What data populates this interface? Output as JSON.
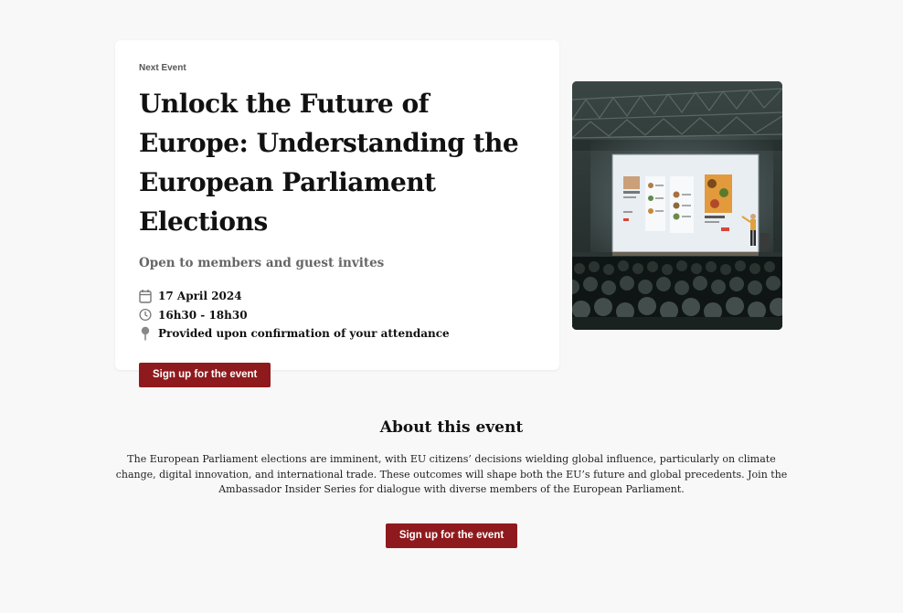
{
  "event": {
    "eyebrow": "Next Event",
    "title": "Unlock the Future of Europe: Understanding the European Parliament Elections",
    "subtitle": "Open to members and guest invites",
    "date": "17 April 2024",
    "time": "16h30 - 18h30",
    "location": "Provided upon confirmation of your attendance",
    "signup_label": "Sign up for the event"
  },
  "about": {
    "title": "About this event",
    "text": "The European Parliament elections are imminent, with EU citizens’ decisions wielding global influence, particularly on climate change, digital innovation, and international trade. These outcomes will shape both the EU’s future and global precedents. Join the Ambassador Insider Series for dialogue with diverse members of the European Parliament.",
    "signup_label": "Sign up for the event"
  },
  "icons": {
    "date": "calendar-icon",
    "time": "clock-icon",
    "location": "map-pin-icon"
  },
  "colors": {
    "accent": "#8f1a1d",
    "background": "#f8f8f8",
    "card": "#ffffff"
  }
}
